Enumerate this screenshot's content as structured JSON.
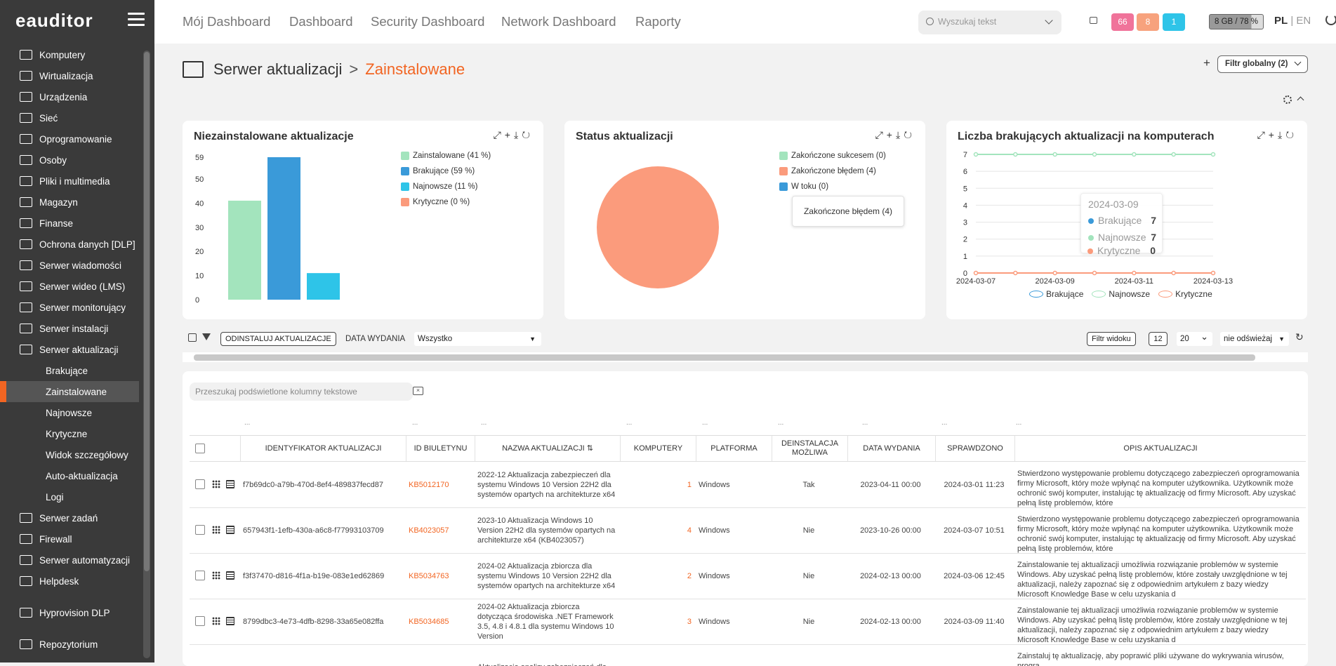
{
  "app": {
    "logo": "eauditor"
  },
  "sidebar": {
    "items": [
      {
        "label": "Komputery",
        "icon": "monitor-icon"
      },
      {
        "label": "Wirtualizacja",
        "icon": "server-stack-icon"
      },
      {
        "label": "Urządzenia",
        "icon": "devices-icon"
      },
      {
        "label": "Sieć",
        "icon": "network-icon"
      },
      {
        "label": "Oprogramowanie",
        "icon": "software-icon"
      },
      {
        "label": "Osoby",
        "icon": "people-icon"
      },
      {
        "label": "Pliki i multimedia",
        "icon": "file-icon"
      },
      {
        "label": "Magazyn",
        "icon": "warehouse-icon"
      },
      {
        "label": "Finanse",
        "icon": "finance-icon"
      },
      {
        "label": "Ochrona danych [DLP]",
        "icon": "shield-icon"
      },
      {
        "label": "Serwer wiadomości",
        "icon": "mail-icon"
      },
      {
        "label": "Serwer wideo (LMS)",
        "icon": "video-icon"
      },
      {
        "label": "Serwer monitorujący",
        "icon": "monitoring-icon"
      },
      {
        "label": "Serwer instalacji",
        "icon": "install-icon"
      },
      {
        "label": "Serwer aktualizacji",
        "icon": "update-server-icon"
      }
    ],
    "subitems": [
      "Brakujące",
      "Zainstalowane",
      "Najnowsze",
      "Krytyczne",
      "Widok szczegółowy",
      "Auto-aktualizacja",
      "Logi"
    ],
    "items2": [
      {
        "label": "Serwer zadań",
        "icon": "tasks-icon"
      },
      {
        "label": "Firewall",
        "icon": "firewall-icon"
      },
      {
        "label": "Serwer automatyzacji",
        "icon": "automation-icon"
      },
      {
        "label": "Helpdesk",
        "icon": "helpdesk-icon"
      },
      {
        "label": "Hyprovision DLP",
        "icon": "dlp-icon"
      },
      {
        "label": "Repozytorium",
        "icon": "folder-icon"
      }
    ]
  },
  "topnav": [
    "Mój Dashboard",
    "Dashboard",
    "Security Dashboard",
    "Network Dashboard",
    "Raporty"
  ],
  "search": {
    "placeholder": "Wyszukaj tekst"
  },
  "badges": [
    {
      "value": "66",
      "color": "#f0739a"
    },
    {
      "value": "8",
      "color": "#f7a27d"
    },
    {
      "value": "1",
      "color": "#2ec4e8"
    }
  ],
  "memory": {
    "label": "8 GB / 78 %",
    "used_percent": 78
  },
  "lang": {
    "active": "PL",
    "sep": " | ",
    "other": "EN"
  },
  "breadcrumb": {
    "parent": "Serwer aktualizacji",
    "sep": ">",
    "current": "Zainstalowane"
  },
  "global_filter": {
    "label": "Filtr globalny (2)"
  },
  "colors": {
    "accent": "#f26522",
    "installed": "#a3e4bd",
    "missing": "#3a9ad9",
    "newest": "#2ec4e8",
    "critical": "#fb9b7c"
  },
  "panels": {
    "p1": {
      "title": "Niezainstalowane aktualizacje",
      "legend": [
        "Zainstalowane (41 %)",
        "Brakujące (59 %)",
        "Najnowsze (11 %)",
        "Krytyczne (0 %)"
      ]
    },
    "p2": {
      "title": "Status aktualizacji",
      "legend": [
        "Zakończone sukcesem (0)",
        "Zakończone błędem (4)",
        "W toku (0)"
      ],
      "tooltip": "Zakończone błędem (4)"
    },
    "p3": {
      "title": "Liczba brakujących aktualizacji na komputerach",
      "legend": [
        "Brakujące",
        "Najnowsze",
        "Krytyczne"
      ],
      "tooltip": {
        "date": "2024-03-09",
        "rows": [
          {
            "name": "Brakujące",
            "value": "7"
          },
          {
            "name": "Najnowsze",
            "value": "7"
          },
          {
            "name": "Krytyczne",
            "value": "0"
          }
        ]
      }
    }
  },
  "chart_data": [
    {
      "type": "bar",
      "title": "Niezainstalowane aktualizacje",
      "categories": [
        "Zainstalowane",
        "Brakujące",
        "Najnowsze",
        "Krytyczne"
      ],
      "values": [
        41,
        59,
        11,
        0
      ],
      "yticks": [
        0,
        10,
        20,
        30,
        40,
        50,
        59
      ],
      "ylim": [
        0,
        59
      ],
      "legend_position": "right"
    },
    {
      "type": "pie",
      "title": "Status aktualizacji",
      "categories": [
        "Zakończone sukcesem",
        "Zakończone błędem",
        "W toku"
      ],
      "values": [
        0,
        4,
        0
      ],
      "legend_position": "right"
    },
    {
      "type": "line",
      "title": "Liczba brakujących aktualizacji na komputerach",
      "x": [
        "2024-03-07",
        "2024-03-08",
        "2024-03-09",
        "2024-03-10",
        "2024-03-11",
        "2024-03-12",
        "2024-03-13"
      ],
      "xticks": [
        "2024-03-07",
        "2024-03-09",
        "2024-03-11",
        "2024-03-13"
      ],
      "ylim": [
        0,
        7
      ],
      "yticks": [
        0,
        1,
        2,
        3,
        4,
        5,
        6,
        7
      ],
      "grid": true,
      "legend_position": "bottom",
      "series": [
        {
          "name": "Brakujące",
          "values": [
            7,
            7,
            7,
            7,
            7,
            7,
            7
          ]
        },
        {
          "name": "Najnowsze",
          "values": [
            7,
            7,
            7,
            7,
            7,
            7,
            7
          ]
        },
        {
          "name": "Krytyczne",
          "values": [
            0,
            0,
            0,
            0,
            0,
            0,
            0
          ]
        }
      ]
    }
  ],
  "toolbar": {
    "uninstall": "ODINSTALUJ AKTUALIZACJE",
    "date_label": "DATA WYDANIA",
    "date_value": "Wszystko",
    "view_filter": "Filtr widoku",
    "count": "12",
    "page_size": "20",
    "refresh": "nie odświeżaj"
  },
  "table": {
    "search_placeholder": "Przeszukaj podświetlone kolumny tekstowe",
    "filter_dots": "...",
    "headers": [
      "IDENTYFIKATOR AKTUALIZACJI",
      "ID BIULETYNU",
      "NAZWA AKTUALIZACJI ⇅",
      "KOMPUTERY",
      "PLATFORMA",
      "DEINSTALACJA MOŻLIWA",
      "DATA WYDANIA",
      "SPRAWDZONO",
      "OPIS AKTUALIZACJI"
    ],
    "rows": [
      {
        "id": "f7b69dc0-a79b-470d-8ef4-489837fecd87",
        "kb": "KB5012170",
        "name": "2022-12 Aktualizacja zabezpieczeń dla systemu Windows 10 Version 22H2 dla systemów opartych na architekturze x64",
        "computers": "1",
        "platform": "Windows",
        "uninstall": "Tak",
        "date": "2023-04-11 00:00",
        "checked": "2024-03-01 11:23",
        "desc": "Stwierdzono występowanie problemu dotyczącego zabezpieczeń oprogramowania firmy Microsoft, który może wpłynąć na komputer użytkownika. Użytkownik może ochronić swój komputer, instalując tę aktualizację od firmy Microsoft. Aby uzyskać pełną listę problemów, które"
      },
      {
        "id": "657943f1-1efb-430a-a6c8-f77993103709",
        "kb": "KB4023057",
        "name": "2023-10 Aktualizacja Windows 10 Version 22H2 dla systemów opartych na architekturze x64 (KB4023057)",
        "computers": "4",
        "platform": "Windows",
        "uninstall": "Nie",
        "date": "2023-10-26 00:00",
        "checked": "2024-03-07 10:51",
        "desc": "Stwierdzono występowanie problemu dotyczącego zabezpieczeń oprogramowania firmy Microsoft, który może wpłynąć na komputer użytkownika. Użytkownik może ochronić swój komputer, instalując tę aktualizację od firmy Microsoft. Aby uzyskać pełną listę problemów, które"
      },
      {
        "id": "f3f37470-d816-4f1a-b19e-083e1ed62869",
        "kb": "KB5034763",
        "name": "2024-02 Aktualizacja zbiorcza dla systemu Windows 10 Version 22H2 dla systemów opartych na architekturze x64",
        "computers": "2",
        "platform": "Windows",
        "uninstall": "Nie",
        "date": "2024-02-13 00:00",
        "checked": "2024-03-06 12:45",
        "desc": "Zainstalowanie tej aktualizacji umożliwia rozwiązanie problemów w systemie Windows. Aby uzyskać pełną listę problemów, które zostały uwzględnione w tej aktualizacji, należy zapoznać się z odpowiednim artykułem z bazy wiedzy Microsoft Knowledge Base w celu uzyskania d"
      },
      {
        "id": "8799dbc3-4e73-4dfb-8298-33a65e082ffa",
        "kb": "KB5034685",
        "name": "2024-02 Aktualizacja zbiorcza dotycząca środowiska .NET Framework 3.5, 4.8 i 4.8.1 dla systemu Windows 10 Version",
        "computers": "3",
        "platform": "Windows",
        "uninstall": "Nie",
        "date": "2024-02-13 00:00",
        "checked": "2024-03-09 11:40",
        "desc": "Zainstalowanie tej aktualizacji umożliwia rozwiązanie problemów w systemie Windows. Aby uzyskać pełną listę problemów, które zostały uwzględnione w tej aktualizacji, należy zapoznać się z odpowiednim artykułem z bazy wiedzy Microsoft Knowledge Base w celu uzyskania d"
      },
      {
        "id": "",
        "kb": "",
        "name": "Aktualizacja analizy zabezpieczeń dla",
        "computers": "",
        "platform": "",
        "uninstall": "",
        "date": "",
        "checked": "",
        "desc": "Zainstaluj tę aktualizację, aby poprawić pliki używane do wykrywania wirusów, progra"
      }
    ]
  }
}
